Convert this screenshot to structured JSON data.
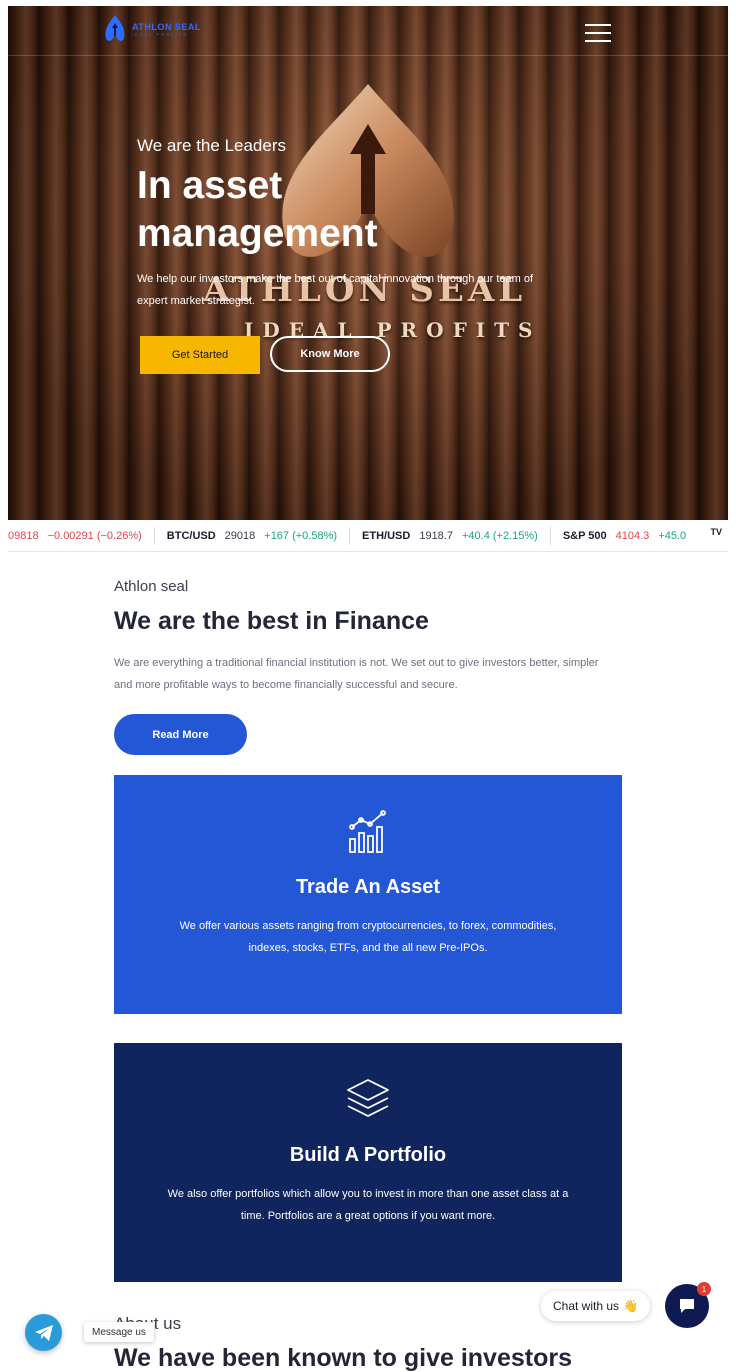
{
  "brand": {
    "name": "ATHLON SEAL",
    "tagline": "IDEAL PROFITS"
  },
  "hero": {
    "kicker": "We are the Leaders",
    "title_line1": "In asset",
    "title_line2": "management",
    "description": "We help our investors make the best out of capital innovation through our team of expert market strategist.",
    "primary_button": "Get Started",
    "secondary_button": "Know More"
  },
  "ticker": [
    {
      "symbol": "",
      "price": "09818",
      "change": "−0.00291 (−0.26%)",
      "direction": "down"
    },
    {
      "symbol": "BTC/USD",
      "price": "29018",
      "change": "+167 (+0.58%)",
      "direction": "up"
    },
    {
      "symbol": "ETH/USD",
      "price": "1918.7",
      "change": "+40.4 (+2.15%)",
      "direction": "up"
    },
    {
      "symbol": "S&P 500",
      "price": "4104.3",
      "change": "+45.0",
      "direction": "mixed"
    }
  ],
  "ticker_logo": "TV",
  "intro": {
    "kicker": "Athlon seal",
    "title": "We are the best in Finance",
    "description": "We are everything a traditional financial institution is not. We set out to give investors better, simpler and more profitable ways to become financially successful and secure.",
    "button": "Read More"
  },
  "cards": [
    {
      "icon": "chart-growth-icon",
      "title": "Trade An Asset",
      "description": "We offer various assets ranging from cryptocurrencies, to forex, commodities, indexes, stocks, ETFs, and the all new Pre-IPOs.",
      "color": "#2457d6"
    },
    {
      "icon": "layers-icon",
      "title": "Build A Portfolio",
      "description": "We also offer portfolios which allow you to invest in more than one asset class at a time. Portfolios are a great options if you want more.",
      "color": "#10245d"
    }
  ],
  "about": {
    "kicker": "About us",
    "title": "We have been known to give investors"
  },
  "widgets": {
    "telegram_label": "Message us",
    "chat_label": "Chat with us",
    "chat_emoji": "👋",
    "chat_badge": "1"
  },
  "colors": {
    "accent_blue": "#2457d6",
    "navy": "#10245d",
    "yellow": "#f7b600",
    "down": "#e0464c",
    "up": "#19a67a"
  }
}
